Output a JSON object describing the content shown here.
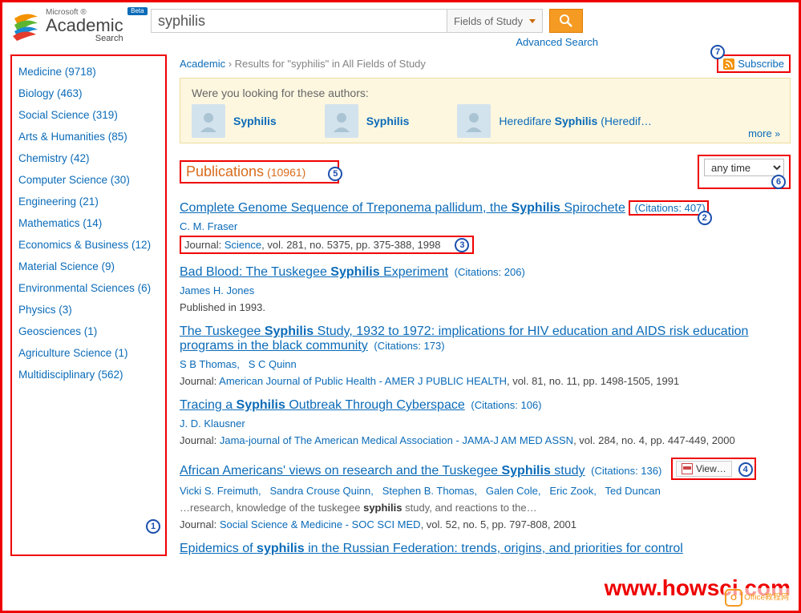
{
  "logo": {
    "ms": "Microsoft ®",
    "academic": "Academic",
    "search": "Search",
    "beta": "Beta"
  },
  "search": {
    "value": "syphilis",
    "fields_label": "Fields of Study",
    "advanced": "Advanced Search"
  },
  "sidebar": {
    "items": [
      {
        "label": "Medicine (9718)"
      },
      {
        "label": "Biology (463)"
      },
      {
        "label": "Social Science (319)"
      },
      {
        "label": "Arts & Humanities (85)"
      },
      {
        "label": "Chemistry (42)"
      },
      {
        "label": "Computer Science (30)"
      },
      {
        "label": "Engineering (21)"
      },
      {
        "label": "Mathematics (14)"
      },
      {
        "label": "Economics & Business (12)"
      },
      {
        "label": "Material Science (9)"
      },
      {
        "label": "Environmental Sciences (6)"
      },
      {
        "label": "Physics (3)"
      },
      {
        "label": "Geosciences (1)"
      },
      {
        "label": "Agriculture Science (1)"
      },
      {
        "label": "Multidisciplinary (562)"
      }
    ]
  },
  "breadcrumb": {
    "root": "Academic",
    "sep": " › ",
    "rest": "Results for \"syphilis\" in All Fields of Study"
  },
  "subscribe": "Subscribe",
  "dym": {
    "question": "Were you looking for these authors:",
    "items": [
      {
        "pre": "",
        "bold": "Syphilis",
        "post": ""
      },
      {
        "pre": "",
        "bold": "Syphilis",
        "post": ""
      },
      {
        "pre": "Heredifare ",
        "bold": "Syphilis",
        "post": " (Heredif…"
      }
    ],
    "more": "more",
    "chev": "»"
  },
  "pubhdr": {
    "label": "Publications",
    "count": "(10961)"
  },
  "time": {
    "selected": "any time"
  },
  "results": [
    {
      "title_pre": "Complete Genome Sequence of Treponema pallidum, the ",
      "title_bold": "Syphilis",
      "title_post": " Spirochete",
      "citations": "(Citations: 407)",
      "authors": "C. M. Fraser",
      "journal_label": "Journal: ",
      "journal_name": "Science",
      "journal_rest": ", vol. 281, no. 5375, pp. 375-388, 1998"
    },
    {
      "title_pre": "Bad Blood: The Tuskegee ",
      "title_bold": "Syphilis",
      "title_post": " Experiment",
      "citations": "(Citations: 206)",
      "authors": "James H. Jones",
      "pub_line": "Published in 1993."
    },
    {
      "title_pre": "The Tuskegee ",
      "title_bold": "Syphilis",
      "title_post": " Study, 1932 to 1972: implications for HIV education and AIDS risk education programs in the black community",
      "citations": "(Citations: 173)",
      "authors_list": [
        "S B Thomas",
        "S C Quinn"
      ],
      "journal_label": "Journal: ",
      "journal_name": "American Journal of Public Health - AMER J PUBLIC HEALTH",
      "journal_rest": ", vol. 81, no. 11, pp. 1498-1505, 1991"
    },
    {
      "title_pre": "Tracing a ",
      "title_bold": "Syphilis",
      "title_post": " Outbreak Through Cyberspace",
      "citations": "(Citations: 106)",
      "authors": "J. D. Klausner",
      "journal_label": "Journal: ",
      "journal_name": "Jama-journal of The American Medical Association - JAMA-J AM MED ASSN",
      "journal_rest": ", vol. 284, no. 4, pp. 447-449, 2000"
    },
    {
      "title_pre": "African Americans' views on research and the Tuskegee ",
      "title_bold": "Syphilis",
      "title_post": " study",
      "citations": "(Citations: 136)",
      "authors_list": [
        "Vicki S. Freimuth",
        "Sandra Crouse Quinn",
        "Stephen B. Thomas",
        "Galen Cole",
        "Eric Zook",
        "Ted Duncan"
      ],
      "snippet_pre": "…research, knowledge of the tuskegee ",
      "snippet_bold": "syphilis",
      "snippet_post": " study, and reactions to the…",
      "journal_label": "Journal: ",
      "journal_name": "Social Science & Medicine - SOC SCI MED",
      "journal_rest": ", vol. 52, no. 5, pp. 797-808, 2001",
      "view_label": "View…"
    },
    {
      "title_pre": "Epidemics of ",
      "title_bold": "syphilis",
      "title_post": " in the Russian Federation: trends, origins, and priorities for control"
    }
  ],
  "badges": {
    "b1": "1",
    "b2": "2",
    "b3": "3",
    "b4": "4",
    "b5": "5",
    "b6": "6",
    "b7": "7"
  },
  "watermark": {
    "pre": "www.",
    "mid": "howsci",
    "post": ".com",
    "sub": "Office教程网"
  }
}
